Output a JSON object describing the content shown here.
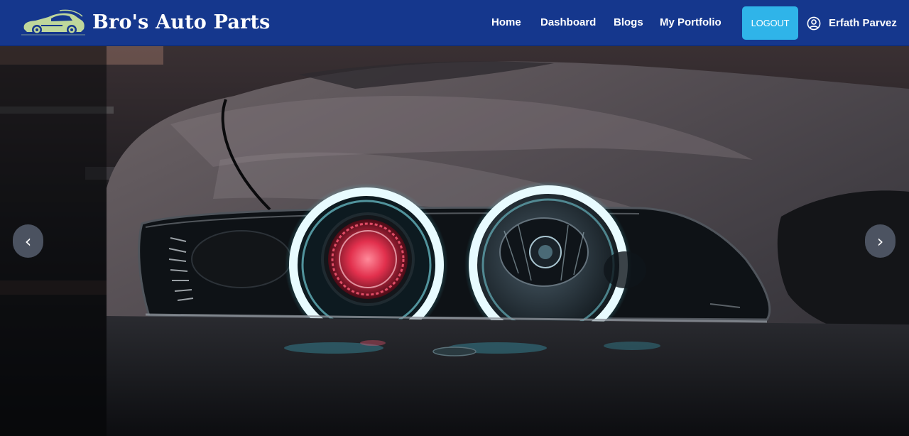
{
  "brand": {
    "name": "Bro's Auto Parts",
    "logo_icon": "car-logo-icon",
    "logo_color": "#bfd79b"
  },
  "nav": {
    "links": [
      {
        "label": "Home"
      },
      {
        "label": "Dashboard"
      },
      {
        "label": "Blogs"
      },
      {
        "label": "My Portfolio"
      }
    ],
    "logout_label": "LOGOUT",
    "user_icon": "user-circle-icon",
    "user_name": "Erfath Parvez"
  },
  "carousel": {
    "prev_glyph": "‹",
    "next_glyph": "›",
    "slide_image": "car-headlight-photo"
  },
  "colors": {
    "navbar": "#15378d",
    "logout_button": "#2fb4e9",
    "carousel_control": "#5c6576",
    "headlight_ring": "#e8fbff",
    "projector_red": "#ff3d5a"
  }
}
